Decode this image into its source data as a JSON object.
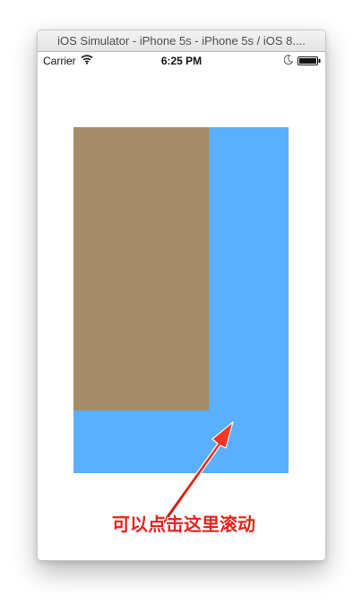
{
  "window": {
    "title": "iOS Simulator - iPhone 5s - iPhone 5s / iOS 8...."
  },
  "status_bar": {
    "carrier": "Carrier",
    "time": "6:25 PM",
    "icons": [
      "wifi-icon",
      "moon-icon",
      "battery-icon"
    ]
  },
  "scroll_area": {
    "background_color": "#5aaffe",
    "content_color": "#a68b69"
  },
  "annotation": {
    "text": "可以点击这里滚动",
    "color": "#e8231c"
  }
}
